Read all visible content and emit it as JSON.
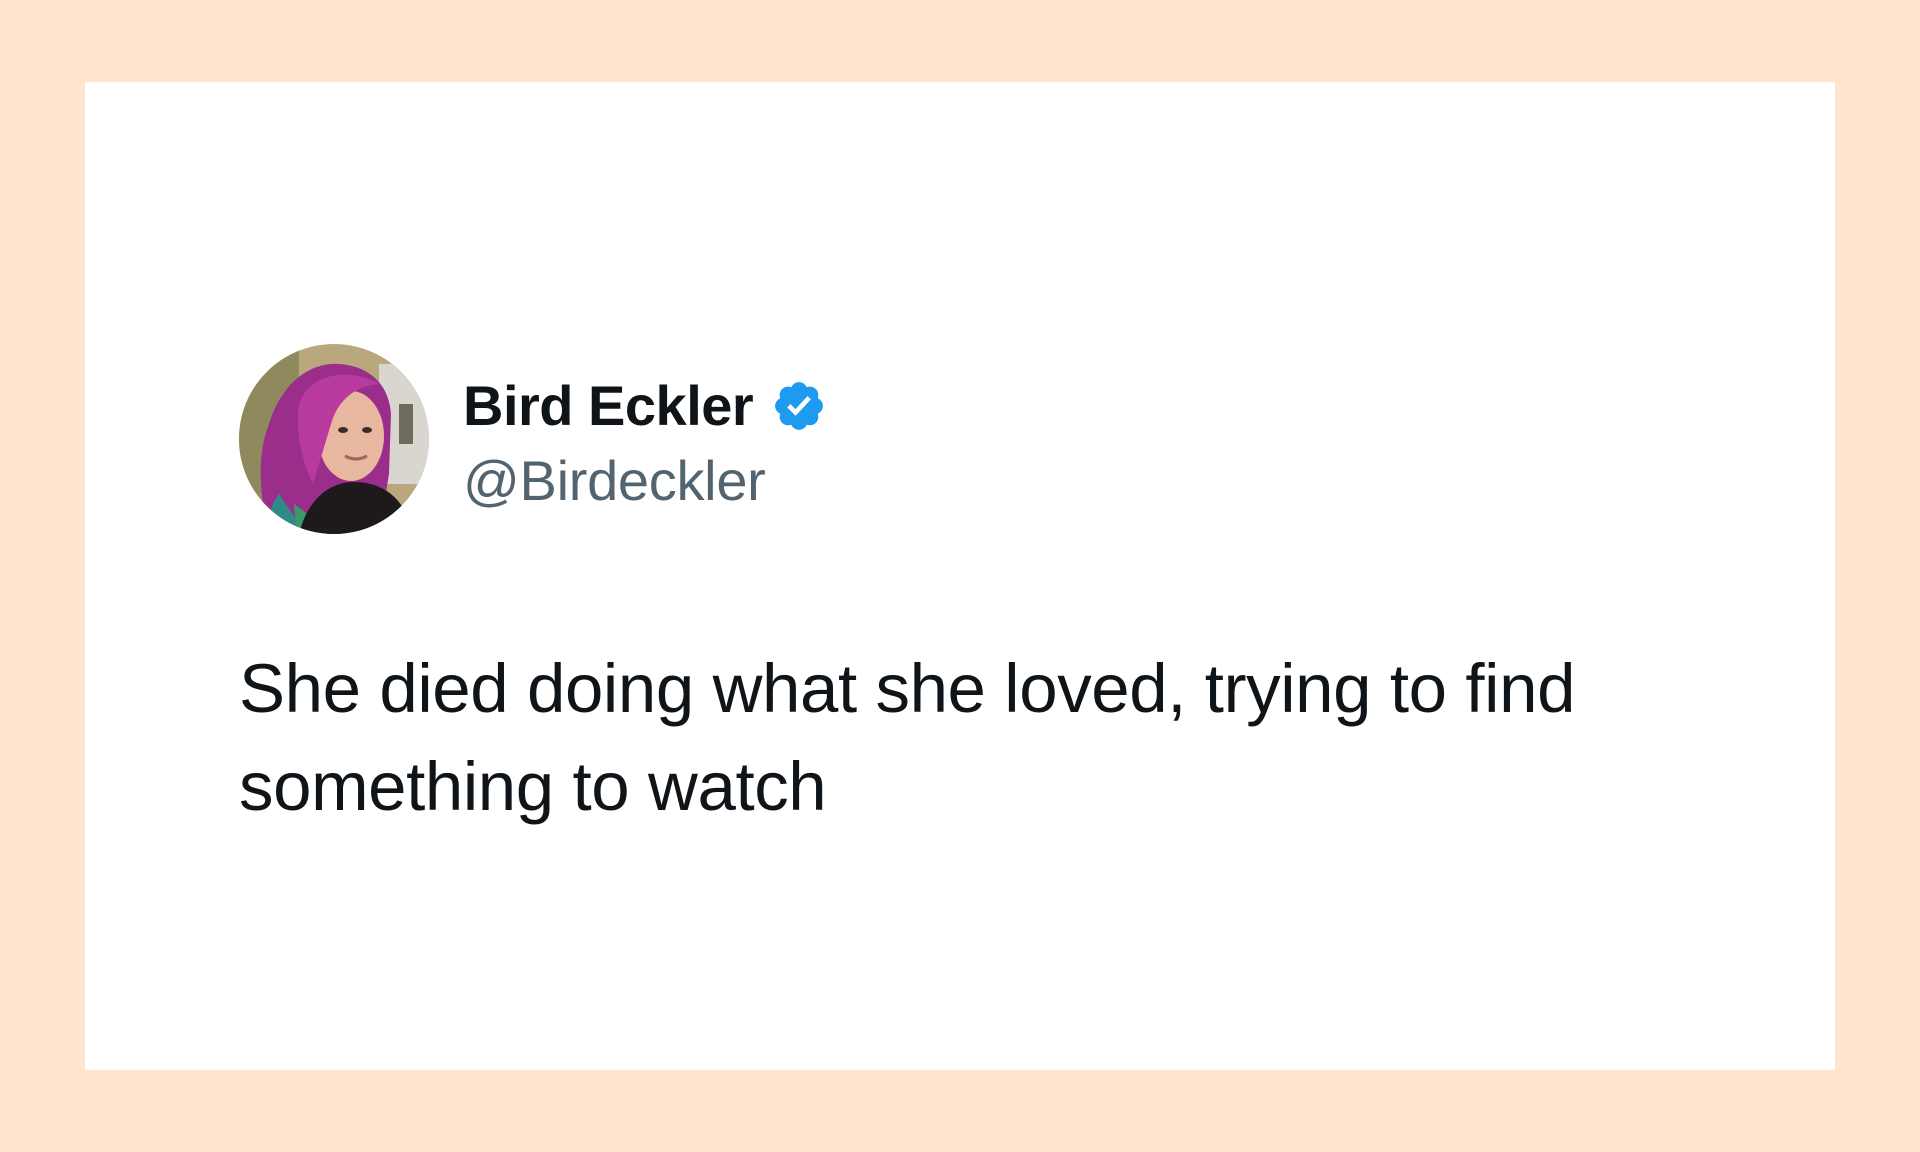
{
  "tweet": {
    "author": {
      "display_name": "Bird Eckler",
      "handle": "@Birdeckler",
      "verified": true,
      "avatar_icon": "profile-photo",
      "verified_icon": "verified-badge-icon"
    },
    "text": "She died doing what she loved, trying to find something to watch"
  },
  "colors": {
    "background": "#FFE4CE",
    "card": "#FFFFFF",
    "text": "#0F1419",
    "handle": "#536471",
    "verified": "#1D9BF0"
  }
}
